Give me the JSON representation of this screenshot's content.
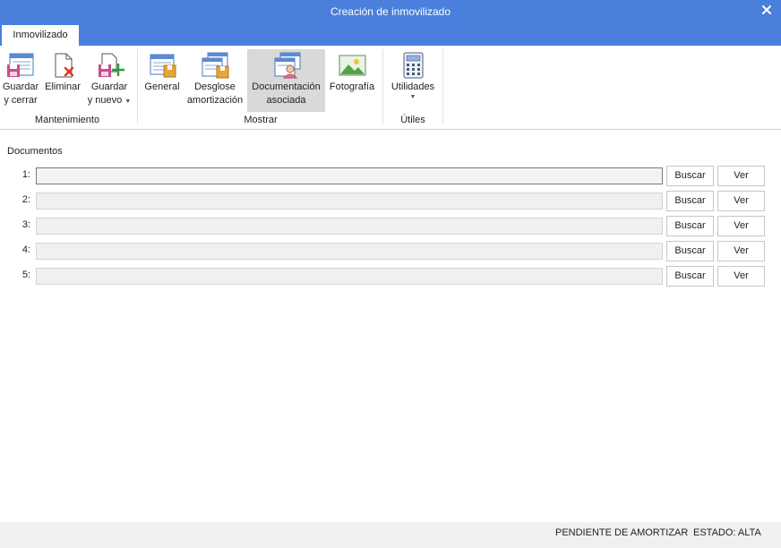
{
  "window": {
    "title": "Creación de inmovilizado"
  },
  "tabs": [
    {
      "label": "Inmovilizado",
      "active": true
    }
  ],
  "ribbon": {
    "groups": [
      {
        "label": "Mantenimiento"
      },
      {
        "label": "Mostrar"
      },
      {
        "label": "Útiles"
      }
    ],
    "buttons": {
      "guardar_cerrar": [
        "Guardar",
        "y cerrar"
      ],
      "eliminar": [
        "Eliminar"
      ],
      "guardar_nuevo": [
        "Guardar",
        "y nuevo"
      ],
      "general": [
        "General"
      ],
      "desglose": [
        "Desglose",
        "amortización"
      ],
      "documentacion": [
        "Documentación",
        "asociada"
      ],
      "fotografia": [
        "Fotografía"
      ],
      "utilidades": [
        "Utilidades"
      ]
    }
  },
  "documents": {
    "title": "Documentos",
    "buscar_label": "Buscar",
    "ver_label": "Ver",
    "rows": [
      {
        "num": "1:",
        "value": ""
      },
      {
        "num": "2:",
        "value": ""
      },
      {
        "num": "3:",
        "value": ""
      },
      {
        "num": "4:",
        "value": ""
      },
      {
        "num": "5:",
        "value": ""
      }
    ]
  },
  "status": {
    "amortizacion": "PENDIENTE DE AMORTIZAR",
    "estado": "ESTADO: ALTA"
  },
  "colors": {
    "titlebar": "#4a7fdc",
    "active_button": "#d9d9d9",
    "status_bg": "#f0f0f0"
  }
}
